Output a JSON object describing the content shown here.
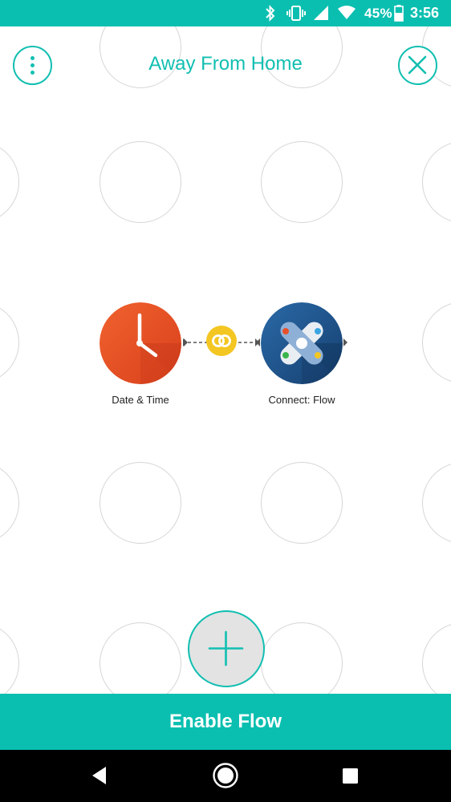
{
  "status_bar": {
    "icons": [
      "bluetooth-icon",
      "vibrate-icon",
      "cell-signal-icon",
      "wifi-icon",
      "battery-icon"
    ],
    "battery_percent": "45%",
    "time": "3:56"
  },
  "header": {
    "title": "Away From Home",
    "menu_icon": "more-vertical-icon",
    "close_icon": "close-icon"
  },
  "flow": {
    "nodes": [
      {
        "label": "Date & Time",
        "icon": "clock-icon",
        "color": "#e8502a"
      },
      {
        "label": "Connect: Flow",
        "icon": "connect-flow-icon",
        "color": "#1b4f88"
      }
    ],
    "connector_icon": "link-rings-icon",
    "connector_color": "#f3c622"
  },
  "add_button": {
    "icon": "plus-icon"
  },
  "enable_button": {
    "label": "Enable Flow"
  },
  "nav_bar": {
    "icons": [
      "back-icon",
      "home-icon",
      "recents-icon"
    ]
  },
  "colors": {
    "accent": "#0abfb0",
    "grid_circle": "#d6d6d6"
  }
}
